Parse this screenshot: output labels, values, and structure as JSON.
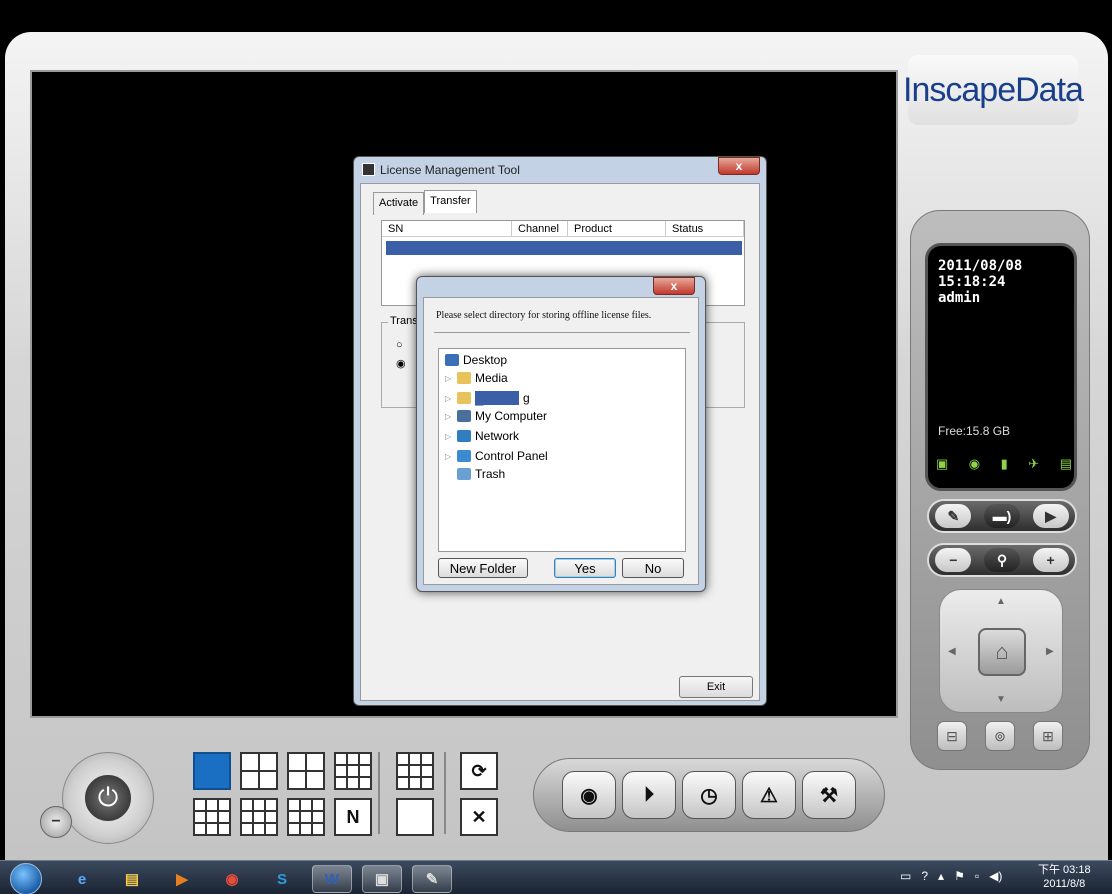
{
  "logo_text": "InscapeData",
  "lcd": {
    "date": "2011/08/08",
    "time": "15:18:24",
    "user": "admin",
    "free": "Free:15.8 GB"
  },
  "license_dialog": {
    "title": "License Management Tool",
    "close": "x",
    "tabs": [
      "Activate",
      "Transfer"
    ],
    "columns": [
      "SN",
      "Channel",
      "Product",
      "Status"
    ],
    "group_label": "Transf",
    "exit": "Exit"
  },
  "folder_dialog": {
    "close": "x",
    "message": "Please select directory for storing offline license files.",
    "tree": [
      "Desktop",
      "Media",
      "g",
      "My Computer",
      "Network",
      "Control Panel",
      "Trash"
    ],
    "new_folder": "New Folder",
    "yes": "Yes",
    "no": "No"
  },
  "taskbar": {
    "clock_line1": "下午 03:18",
    "clock_line2": "2011/8/8"
  }
}
